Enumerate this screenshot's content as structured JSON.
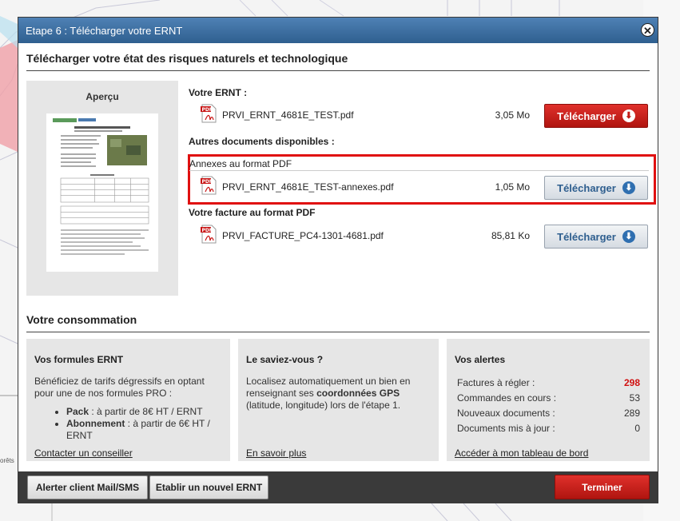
{
  "modal": {
    "title": "Etape 6 : Télécharger votre ERNT",
    "heading": "Télécharger votre état des risques naturels et technologique"
  },
  "background": {
    "side_label": "orêts"
  },
  "preview": {
    "title": "Aperçu"
  },
  "documents": {
    "ernt_label": "Votre ERNT :",
    "ernt_file": {
      "name": "PRVI_ERNT_4681E_TEST.pdf",
      "size": "3,05 Mo",
      "button": "Télécharger"
    },
    "other_label": "Autres documents disponibles :",
    "annex_label": "Annexes au format PDF",
    "annex_file": {
      "name": "PRVI_ERNT_4681E_TEST-annexes.pdf",
      "size": "1,05 Mo",
      "button": "Télécharger"
    },
    "invoice_label": "Votre facture au format PDF",
    "invoice_file": {
      "name": "PRVI_FACTURE_PC4-1301-4681.pdf",
      "size": "85,81 Ko",
      "button": "Télécharger"
    }
  },
  "consumption": {
    "heading": "Votre consommation",
    "formulas": {
      "title": "Vos formules ERNT",
      "text": "Bénéficiez de tarifs dégressifs en optant pour une de nos formules PRO :",
      "pack_name": "Pack",
      "pack_text": " : à partir de 8€ HT / ERNT",
      "sub_name": "Abonnement",
      "sub_text": " : à partir de 6€ HT / ERNT",
      "link": "Contacter un conseiller"
    },
    "tip": {
      "title": "Le saviez-vous ?",
      "text_before": "Localisez automatiquement un bien en renseignant ses ",
      "text_bold": "coordonnées GPS",
      "text_after": " (latitude, longitude) lors de l'étape 1.",
      "link": "En savoir plus"
    },
    "alerts": {
      "title": "Vos alertes",
      "rows": [
        {
          "label": "Factures à régler :",
          "value": "298"
        },
        {
          "label": "Commandes en cours :",
          "value": "53"
        },
        {
          "label": "Nouveaux documents :",
          "value": "289"
        },
        {
          "label": "Documents mis à jour :",
          "value": "0"
        }
      ],
      "link": "Accéder à mon tableau de bord"
    }
  },
  "footer": {
    "alert_button": "Alerter client Mail/SMS",
    "new_button": "Etablir un nouvel ERNT",
    "finish_button": "Terminer"
  },
  "colors": {
    "title_bar": "#3f6f9f",
    "accent_red": "#c11b16",
    "highlight": "#e01010",
    "button_blue": "#2f6fb0"
  }
}
